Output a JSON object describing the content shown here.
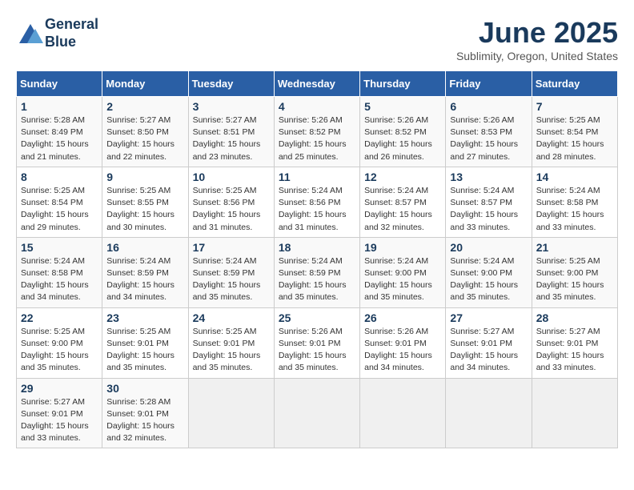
{
  "header": {
    "logo_line1": "General",
    "logo_line2": "Blue",
    "month_year": "June 2025",
    "subtitle": "Sublimity, Oregon, United States"
  },
  "calendar": {
    "weekdays": [
      "Sunday",
      "Monday",
      "Tuesday",
      "Wednesday",
      "Thursday",
      "Friday",
      "Saturday"
    ],
    "weeks": [
      [
        null,
        {
          "day": 2,
          "sunrise": "5:27 AM",
          "sunset": "8:50 PM",
          "daylight": "15 hours and 22 minutes."
        },
        {
          "day": 3,
          "sunrise": "5:27 AM",
          "sunset": "8:51 PM",
          "daylight": "15 hours and 23 minutes."
        },
        {
          "day": 4,
          "sunrise": "5:26 AM",
          "sunset": "8:52 PM",
          "daylight": "15 hours and 25 minutes."
        },
        {
          "day": 5,
          "sunrise": "5:26 AM",
          "sunset": "8:52 PM",
          "daylight": "15 hours and 26 minutes."
        },
        {
          "day": 6,
          "sunrise": "5:26 AM",
          "sunset": "8:53 PM",
          "daylight": "15 hours and 27 minutes."
        },
        {
          "day": 7,
          "sunrise": "5:25 AM",
          "sunset": "8:54 PM",
          "daylight": "15 hours and 28 minutes."
        }
      ],
      [
        {
          "day": 8,
          "sunrise": "5:25 AM",
          "sunset": "8:54 PM",
          "daylight": "15 hours and 29 minutes."
        },
        {
          "day": 9,
          "sunrise": "5:25 AM",
          "sunset": "8:55 PM",
          "daylight": "15 hours and 30 minutes."
        },
        {
          "day": 10,
          "sunrise": "5:25 AM",
          "sunset": "8:56 PM",
          "daylight": "15 hours and 31 minutes."
        },
        {
          "day": 11,
          "sunrise": "5:24 AM",
          "sunset": "8:56 PM",
          "daylight": "15 hours and 31 minutes."
        },
        {
          "day": 12,
          "sunrise": "5:24 AM",
          "sunset": "8:57 PM",
          "daylight": "15 hours and 32 minutes."
        },
        {
          "day": 13,
          "sunrise": "5:24 AM",
          "sunset": "8:57 PM",
          "daylight": "15 hours and 33 minutes."
        },
        {
          "day": 14,
          "sunrise": "5:24 AM",
          "sunset": "8:58 PM",
          "daylight": "15 hours and 33 minutes."
        }
      ],
      [
        {
          "day": 15,
          "sunrise": "5:24 AM",
          "sunset": "8:58 PM",
          "daylight": "15 hours and 34 minutes."
        },
        {
          "day": 16,
          "sunrise": "5:24 AM",
          "sunset": "8:59 PM",
          "daylight": "15 hours and 34 minutes."
        },
        {
          "day": 17,
          "sunrise": "5:24 AM",
          "sunset": "8:59 PM",
          "daylight": "15 hours and 35 minutes."
        },
        {
          "day": 18,
          "sunrise": "5:24 AM",
          "sunset": "8:59 PM",
          "daylight": "15 hours and 35 minutes."
        },
        {
          "day": 19,
          "sunrise": "5:24 AM",
          "sunset": "9:00 PM",
          "daylight": "15 hours and 35 minutes."
        },
        {
          "day": 20,
          "sunrise": "5:24 AM",
          "sunset": "9:00 PM",
          "daylight": "15 hours and 35 minutes."
        },
        {
          "day": 21,
          "sunrise": "5:25 AM",
          "sunset": "9:00 PM",
          "daylight": "15 hours and 35 minutes."
        }
      ],
      [
        {
          "day": 22,
          "sunrise": "5:25 AM",
          "sunset": "9:00 PM",
          "daylight": "15 hours and 35 minutes."
        },
        {
          "day": 23,
          "sunrise": "5:25 AM",
          "sunset": "9:01 PM",
          "daylight": "15 hours and 35 minutes."
        },
        {
          "day": 24,
          "sunrise": "5:25 AM",
          "sunset": "9:01 PM",
          "daylight": "15 hours and 35 minutes."
        },
        {
          "day": 25,
          "sunrise": "5:26 AM",
          "sunset": "9:01 PM",
          "daylight": "15 hours and 35 minutes."
        },
        {
          "day": 26,
          "sunrise": "5:26 AM",
          "sunset": "9:01 PM",
          "daylight": "15 hours and 34 minutes."
        },
        {
          "day": 27,
          "sunrise": "5:27 AM",
          "sunset": "9:01 PM",
          "daylight": "15 hours and 34 minutes."
        },
        {
          "day": 28,
          "sunrise": "5:27 AM",
          "sunset": "9:01 PM",
          "daylight": "15 hours and 33 minutes."
        }
      ],
      [
        {
          "day": 29,
          "sunrise": "5:27 AM",
          "sunset": "9:01 PM",
          "daylight": "15 hours and 33 minutes."
        },
        {
          "day": 30,
          "sunrise": "5:28 AM",
          "sunset": "9:01 PM",
          "daylight": "15 hours and 32 minutes."
        },
        null,
        null,
        null,
        null,
        null
      ]
    ],
    "day1": {
      "day": 1,
      "sunrise": "5:28 AM",
      "sunset": "8:49 PM",
      "daylight": "15 hours and 21 minutes."
    }
  }
}
